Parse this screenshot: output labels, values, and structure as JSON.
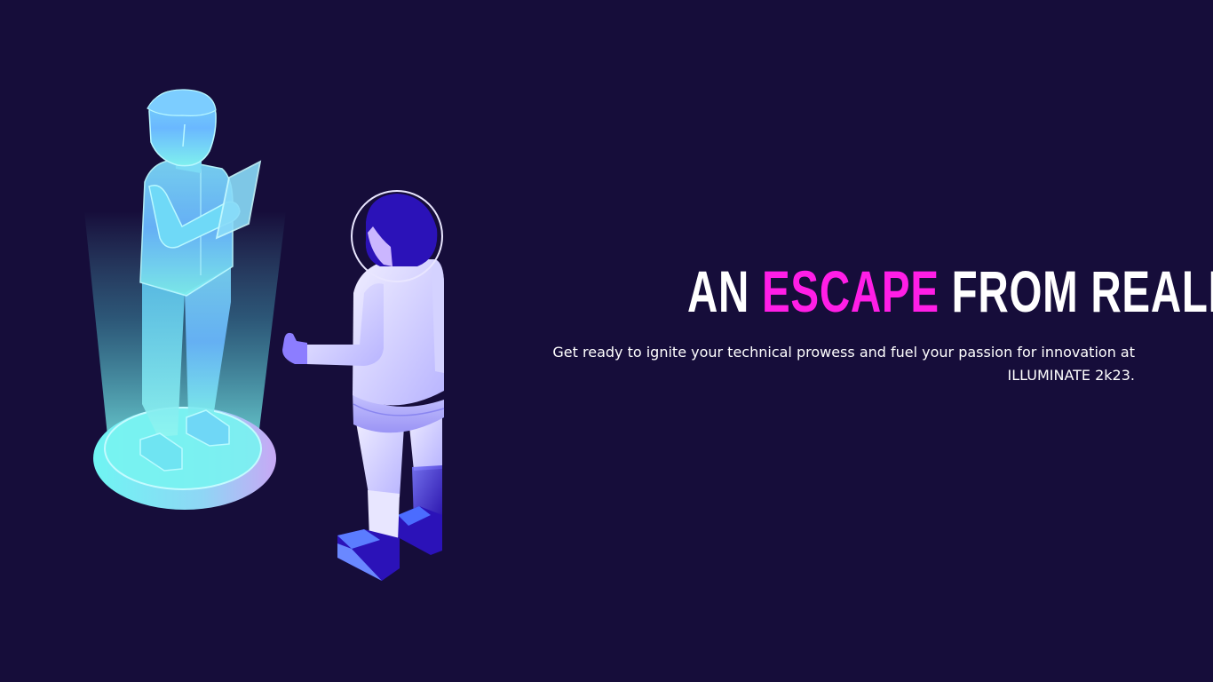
{
  "hero": {
    "headline_part1": "AN ",
    "headline_accent": "ESCAPE",
    "headline_part2": " FROM REALITY",
    "subtitle": "Get ready to ignite your technical prowess and fuel your passion for innovation at ILLUMINATE 2k23."
  },
  "colors": {
    "background": "#160d3a",
    "accent": "#ff1ee6",
    "text": "#ffffff",
    "hologram": "#6ff0f0",
    "astronaut_dark": "#2b12b8"
  },
  "illustration": {
    "icons": [
      "hologram-person-icon",
      "astronaut-icon"
    ]
  }
}
